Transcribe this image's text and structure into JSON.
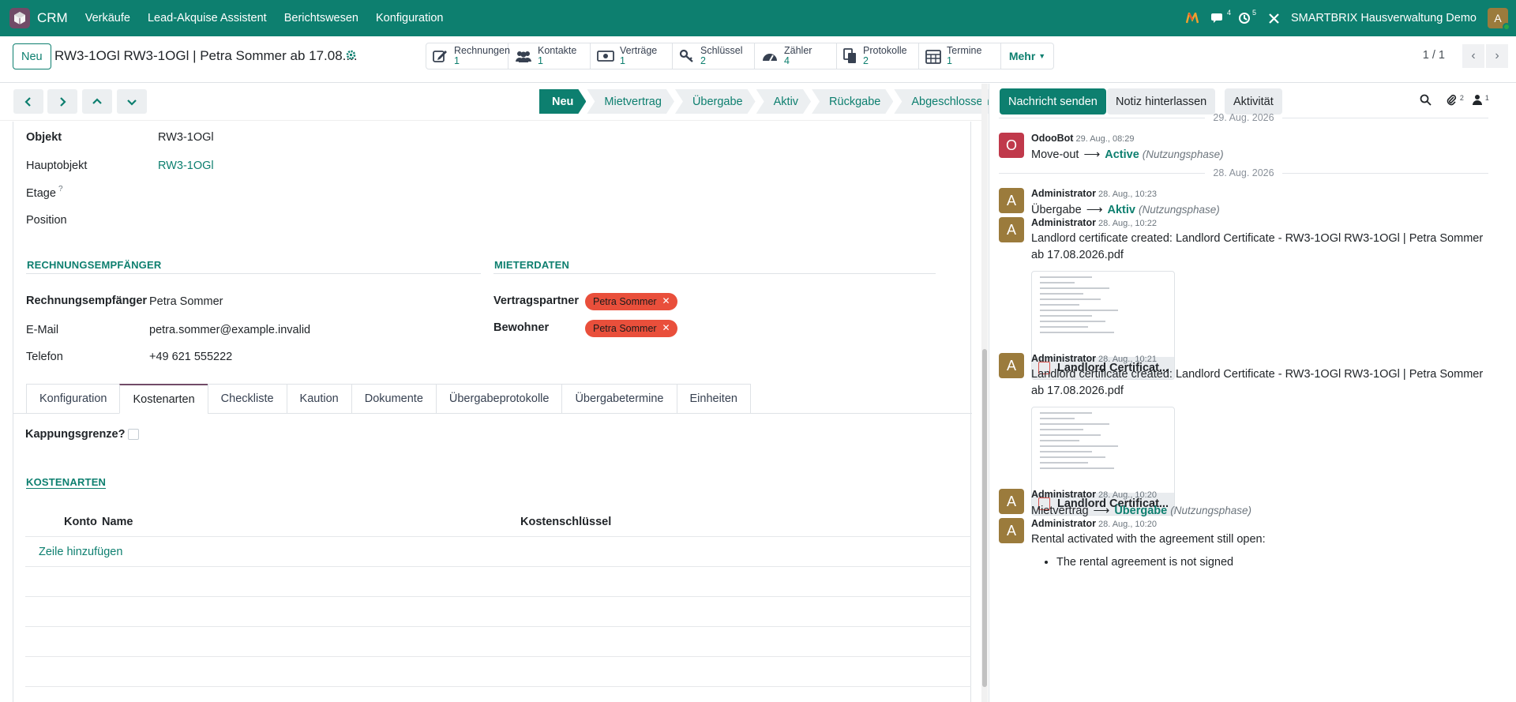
{
  "topbar": {
    "app_name": "CRM",
    "menus": [
      "Verkäufe",
      "Lead-Akquise Assistent",
      "Berichtswesen",
      "Konfiguration"
    ],
    "messages_count": "4",
    "activities_count": "5",
    "company": "SMARTBRIX Hausverwaltung Demo",
    "avatar_letter": "A"
  },
  "control_panel": {
    "new_label": "Neu",
    "record_title": "RW3-1OGl RW3-1OGl | Petra Sommer ab 17.08....",
    "smart_buttons": [
      {
        "label": "Rechnungen",
        "count": "1",
        "icon": "edit-icon"
      },
      {
        "label": "Kontakte",
        "count": "1",
        "icon": "users-icon"
      },
      {
        "label": "Verträge",
        "count": "1",
        "icon": "money-icon"
      },
      {
        "label": "Schlüssel",
        "count": "2",
        "icon": "key-icon"
      },
      {
        "label": "Zähler",
        "count": "4",
        "icon": "gauge-icon"
      },
      {
        "label": "Protokolle",
        "count": "2",
        "icon": "copy-icon"
      },
      {
        "label": "Termine",
        "count": "1",
        "icon": "calendar-icon"
      }
    ],
    "more_label": "Mehr",
    "pager": "1 / 1"
  },
  "statusbar": {
    "stages": [
      "Neu",
      "Mietvertrag",
      "Übergabe",
      "Aktiv",
      "Rückgabe",
      "Abgeschlossen"
    ],
    "active": "Neu"
  },
  "form": {
    "objekt_label": "Objekt",
    "objekt_value": "RW3-1OGl",
    "hauptobjekt_label": "Hauptobjekt",
    "hauptobjekt_value": "RW3-1OGl",
    "etage_label": "Etage",
    "etage_help": "?",
    "position_label": "Position",
    "section_left": "RECHNUNGSEMPFÄNGER",
    "section_right": "MIETERDATEN",
    "rechnungsempfaenger_label": "Rechnungsempfänger",
    "rechnungsempfaenger_value": "Petra Sommer",
    "email_label": "E-Mail",
    "email_value": "petra.sommer@example.invalid",
    "telefon_label": "Telefon",
    "telefon_value": "+49 621 555222",
    "vertragspartner_label": "Vertragspartner",
    "vertragspartner_tag": "Petra Sommer",
    "bewohner_label": "Bewohner",
    "bewohner_tag": "Petra Sommer",
    "tabs": [
      "Konfiguration",
      "Kostenarten",
      "Checkliste",
      "Kaution",
      "Dokumente",
      "Übergabeprotokolle",
      "Übergabetermine",
      "Einheiten"
    ],
    "active_tab": "Kostenarten",
    "kappung_label": "Kappungsgrenze?",
    "kostenarten_section": "KOSTENARTEN",
    "table_headers": [
      "Konto",
      "Name",
      "Kostenschlüssel"
    ],
    "add_line": "Zeile hinzufügen"
  },
  "chatter": {
    "send_message": "Nachricht senden",
    "log_note": "Notiz hinterlassen",
    "activity": "Aktivität",
    "attachments_count": "2",
    "followers_count": "1",
    "day1": "29. Aug. 2026",
    "day2": "28. Aug. 2026",
    "messages": [
      {
        "author": "OdooBot",
        "avatar": "O",
        "date": "29. Aug., 08:29",
        "old": "Move-out",
        "new": "Active",
        "field": "(Nutzungsphase)"
      },
      {
        "author": "Administrator",
        "avatar": "A",
        "date": "28. Aug., 10:23",
        "old": "Übergabe",
        "new": "Aktiv",
        "field": "(Nutzungsphase)"
      },
      {
        "author": "Administrator",
        "avatar": "A",
        "date": "28. Aug., 10:22",
        "text": "Landlord certificate created: Landlord Certificate - RW3-1OGl RW3-1OGl | Petra Sommer ab 17.08.2026.pdf",
        "attachment": "Landlord Certificat..."
      },
      {
        "author": "Administrator",
        "avatar": "A",
        "date": "28. Aug., 10:21",
        "text": "Landlord certificate created: Landlord Certificate - RW3-1OGl RW3-1OGl | Petra Sommer ab 17.08.2026.pdf",
        "attachment": "Landlord Certificat..."
      },
      {
        "author": "Administrator",
        "avatar": "A",
        "date": "28. Aug., 10:20",
        "old": "Mietvertrag",
        "new": "Übergabe",
        "field": "(Nutzungsphase)"
      },
      {
        "author": "Administrator",
        "avatar": "A",
        "date": "28. Aug., 10:20",
        "text": "Rental activated with the agreement still open:",
        "bullet": "The rental agreement is not signed"
      }
    ],
    "arrow": "⟶"
  },
  "colors": {
    "brand": "#0d7f6f",
    "tag": "#e94f3b",
    "odoobot_avatar": "#c0394b",
    "admin_avatar": "#9b7b3c",
    "active_tab": "#714b67"
  }
}
